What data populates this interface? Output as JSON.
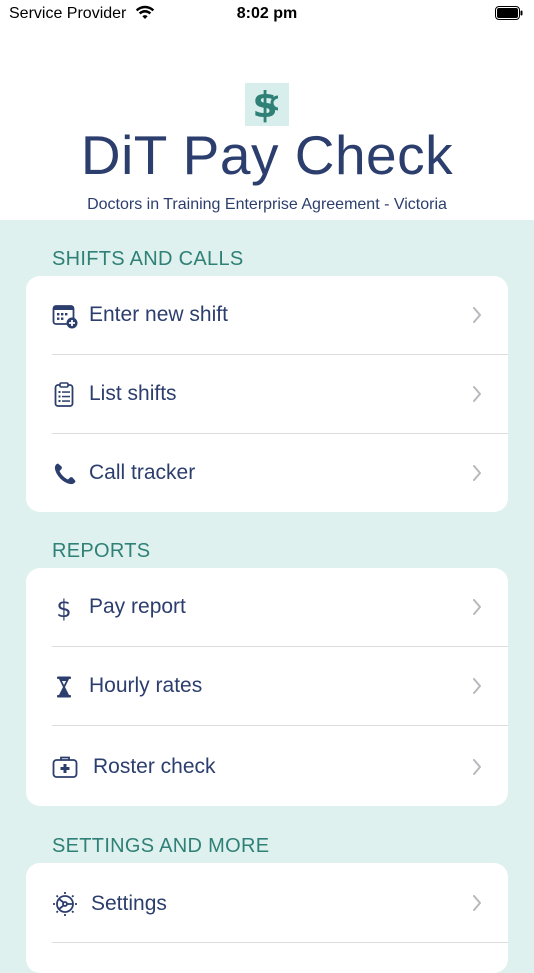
{
  "status_bar": {
    "carrier": "Service Provider",
    "time": "8:02 pm"
  },
  "header": {
    "title": "DiT Pay Check",
    "subtitle": "Doctors in Training Enterprise Agreement - Victoria",
    "logo_icon": "dollar-logo-icon"
  },
  "sections": [
    {
      "title": "SHIFTS AND CALLS",
      "items": [
        {
          "label": "Enter new shift",
          "icon": "calendar-add-icon"
        },
        {
          "label": "List shifts",
          "icon": "clipboard-list-icon"
        },
        {
          "label": "Call tracker",
          "icon": "phone-icon"
        }
      ]
    },
    {
      "title": "REPORTS",
      "items": [
        {
          "label": "Pay report",
          "icon": "dollar-icon"
        },
        {
          "label": "Hourly rates",
          "icon": "hourglass-icon"
        },
        {
          "label": "Roster check",
          "icon": "medical-kit-icon"
        }
      ]
    },
    {
      "title": "SETTINGS AND MORE",
      "items": [
        {
          "label": "Settings",
          "icon": "gear-icon"
        }
      ]
    }
  ],
  "colors": {
    "accent": "#2f8076",
    "text": "#2c3e6d",
    "background": "#dff1ef",
    "card": "#ffffff"
  }
}
